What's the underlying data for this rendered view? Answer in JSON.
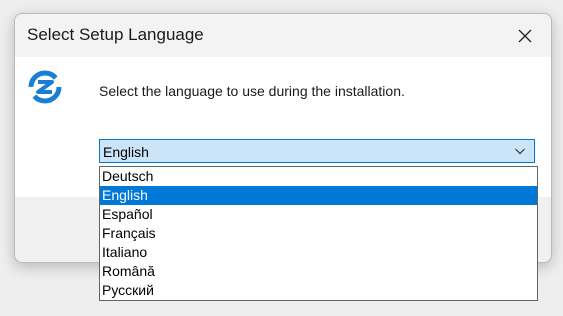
{
  "window": {
    "title": "Select Setup Language"
  },
  "content": {
    "prompt": "Select the language to use during the installation."
  },
  "language_select": {
    "selected": "English",
    "options": [
      "Deutsch",
      "English",
      "Español",
      "Français",
      "Italiano",
      "Română",
      "Русский"
    ],
    "highlighted_index": 1
  },
  "colors": {
    "accent": "#0078d7",
    "logo": "#1a7fd4"
  },
  "icons": {
    "app": "setup-logo-icon",
    "close": "close-icon",
    "dropdown": "chevron-down-icon"
  }
}
